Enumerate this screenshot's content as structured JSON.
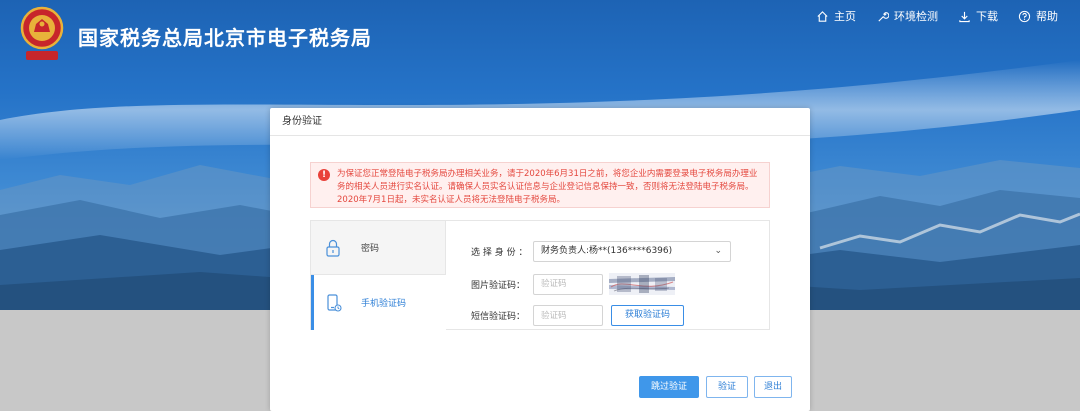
{
  "header": {
    "site_title": "国家税务总局北京市电子税务局",
    "nav": [
      {
        "label": "主页",
        "icon": "home-icon"
      },
      {
        "label": "环境检测",
        "icon": "wrench-icon"
      },
      {
        "label": "下载",
        "icon": "download-icon"
      },
      {
        "label": "帮助",
        "icon": "help-icon"
      }
    ]
  },
  "dialog": {
    "title": "身份验证",
    "notice": "为保证您正常登陆电子税务局办理相关业务，请于2020年6月31日之前，将您企业内需要登录电子税务局办理业务的相关人员进行实名认证。请确保人员实名认证信息与企业登记信息保持一致，否则将无法登陆电子税务局。 2020年7月1日起，未实名认证人员将无法登陆电子税务局。",
    "tabs": [
      {
        "label": "密码",
        "icon": "lock-icon"
      },
      {
        "label": "手机验证码",
        "icon": "mobile-icon"
      }
    ],
    "form": {
      "identity_label": "选 择 身 份 ：",
      "identity_value": "财务负责人:杨**(136****6396)",
      "image_code_label": "图片验证码：",
      "image_code_placeholder": "验证码",
      "sms_code_label": "短信验证码：",
      "sms_code_placeholder": "验证码",
      "get_code_button": "获取验证码"
    },
    "buttons": {
      "skip": "跳过验证",
      "verify": "验证",
      "exit": "退出"
    }
  },
  "colors": {
    "primary": "#3a8ee6",
    "notice_text": "#e4483f",
    "notice_bg": "#fff0ef"
  }
}
